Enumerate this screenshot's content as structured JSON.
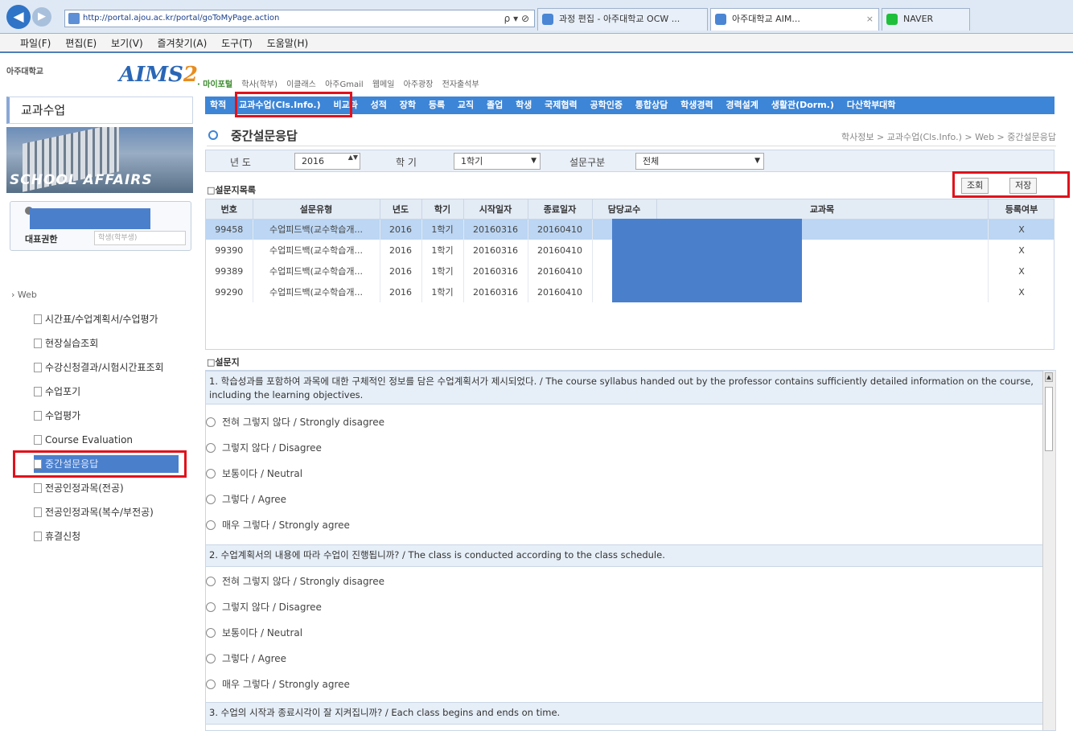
{
  "browser": {
    "address": "http://portal.ajou.ac.kr/portal/goToMyPage.action",
    "address_actions": "ρ ▾ ⊘",
    "tabs": [
      {
        "label": "과정 편집 - 아주대학교 OCW ..."
      },
      {
        "label": "아주대학교 AIM..."
      },
      {
        "label": "NAVER"
      }
    ],
    "close_glyph": "×",
    "back_glyph": "◀",
    "forward_glyph": "▶"
  },
  "menubar": {
    "items": [
      "파일(F)",
      "편집(E)",
      "보기(V)",
      "즐겨찾기(A)",
      "도구(T)",
      "도움말(H)"
    ]
  },
  "sidebar": {
    "university": "아주대학교",
    "logo_text": "AIMS",
    "logo_num": "2",
    "section_title": "교과수업",
    "banner_text": "SCHOOL AFFAIRS",
    "role_label": "대표권한",
    "role_value": "학생(학부생)",
    "tree_root": "› Web",
    "tree": [
      "시간표/수업계획서/수업평가",
      "현장실습조회",
      "수강신청결과/시험시간표조회",
      "수업포기",
      "수업평가",
      "Course Evaluation",
      "중간설문응답",
      "전공인정과목(전공)",
      "전공인정과목(복수/부전공)",
      "휴결신청"
    ]
  },
  "main": {
    "top_links": [
      "· 마이포털",
      "학사(학부)",
      "이클래스",
      "아주Gmail",
      "웹메일",
      "아주광장",
      "전자출석부"
    ],
    "nav": [
      "학적",
      "교과수업(Cls.Info.)",
      "비교과",
      "성적",
      "장학",
      "등록",
      "교직",
      "졸업",
      "학생",
      "국제협력",
      "공학인증",
      "통합상담",
      "학생경력",
      "경력설계",
      "생활관(Dorm.)",
      "다산학부대학"
    ],
    "page_title": "중간설문응답",
    "breadcrumb": "학사정보 > 교과수업(Cls.Info.) > Web > 중간설문응답",
    "filter": {
      "year_label": "년 도",
      "year_value": "2016",
      "term_label": "학 기",
      "term_value": "1학기",
      "type_label": "설문구분",
      "type_value": "전체",
      "spin_glyph": "▲▼",
      "caret_glyph": "▼"
    },
    "list_title": "□설문지목록",
    "buttons": {
      "search": "조회",
      "save": "저장"
    },
    "grid": {
      "headers": [
        "번호",
        "설문유형",
        "년도",
        "학기",
        "시작일자",
        "종료일자",
        "담당교수",
        "교과목",
        "등록여부"
      ],
      "rows": [
        [
          "99458",
          "수업피드백(교수학습개...",
          "2016",
          "1학기",
          "20160316",
          "20160410",
          "",
          "",
          "X"
        ],
        [
          "99390",
          "수업피드백(교수학습개...",
          "2016",
          "1학기",
          "20160316",
          "20160410",
          "",
          "",
          "X"
        ],
        [
          "99389",
          "수업피드백(교수학습개...",
          "2016",
          "1학기",
          "20160316",
          "20160410",
          "",
          "",
          "X"
        ],
        [
          "99290",
          "수업피드백(교수학습개...",
          "2016",
          "1학기",
          "20160316",
          "20160410",
          "",
          "",
          "X"
        ]
      ]
    },
    "survey_title": "□설문지",
    "questions": [
      {
        "text": "1. 학습성과를 포함하여 과목에 대한 구체적인 정보를 담은 수업계획서가 제시되었다. / The course syllabus handed out by the professor contains sufficiently detailed information on the course, including the learning objectives.",
        "options": [
          "전혀 그렇지 않다 / Strongly disagree",
          "그렇지 않다 / Disagree",
          "보통이다 / Neutral",
          "그렇다 / Agree",
          "매우 그렇다 / Strongly agree"
        ]
      },
      {
        "text": "2. 수업계획서의 내용에 따라 수업이 진행됩니까? / The class is conducted according to the class schedule.",
        "options": [
          "전혀 그렇지 않다 / Strongly disagree",
          "그렇지 않다 / Disagree",
          "보통이다 / Neutral",
          "그렇다 / Agree",
          "매우 그렇다 / Strongly agree"
        ]
      },
      {
        "text": "3. 수업의 시작과 종료시각이 잘 지켜집니까? / Each class begins and ends on time.",
        "options": []
      }
    ]
  },
  "colors": {
    "highlight": "#e0121c",
    "nav": "#3d85d6",
    "redact": "#4a7fcc",
    "selected_row": "#bcd6f3"
  }
}
